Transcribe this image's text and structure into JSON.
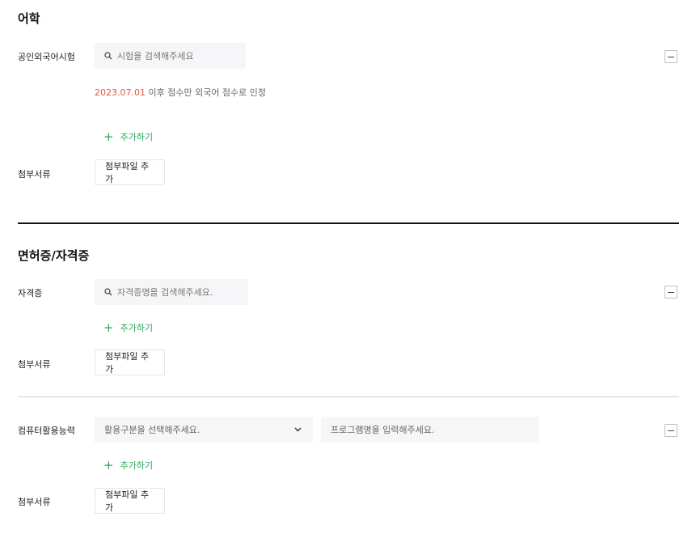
{
  "language": {
    "title": "어학",
    "exam_label": "공인외국어시험",
    "exam_search_placeholder": "시험을 검색해주세요",
    "note_date": "2023.07.01",
    "note_text": " 이후 점수만 외국어 점수로 인정",
    "add_label": "추가하기",
    "attach_label": "첨부서류",
    "attach_button": "첨부파일 추가"
  },
  "license": {
    "title": "면허증/자격증",
    "cert_label": "자격증",
    "cert_search_placeholder": "자격증명을 검색해주세요.",
    "add_label": "추가하기",
    "attach_label": "첨부서류",
    "attach_button": "첨부파일 추가"
  },
  "computer": {
    "label": "컴퓨터활용능력",
    "category_select": "활용구분을 선택해주세요.",
    "program_placeholder": "프로그램명을 입력해주세요.",
    "add_label": "추가하기",
    "attach_label": "첨부서류",
    "attach_button": "첨부파일 추가"
  },
  "icons": {
    "search": "search-icon",
    "remove": "minus-icon",
    "add": "plus-icon",
    "dropdown": "chevron-down-icon"
  },
  "colors": {
    "accent_green": "#2fa35a",
    "date_red": "#e8533f",
    "input_bg": "#f6f6f8"
  }
}
